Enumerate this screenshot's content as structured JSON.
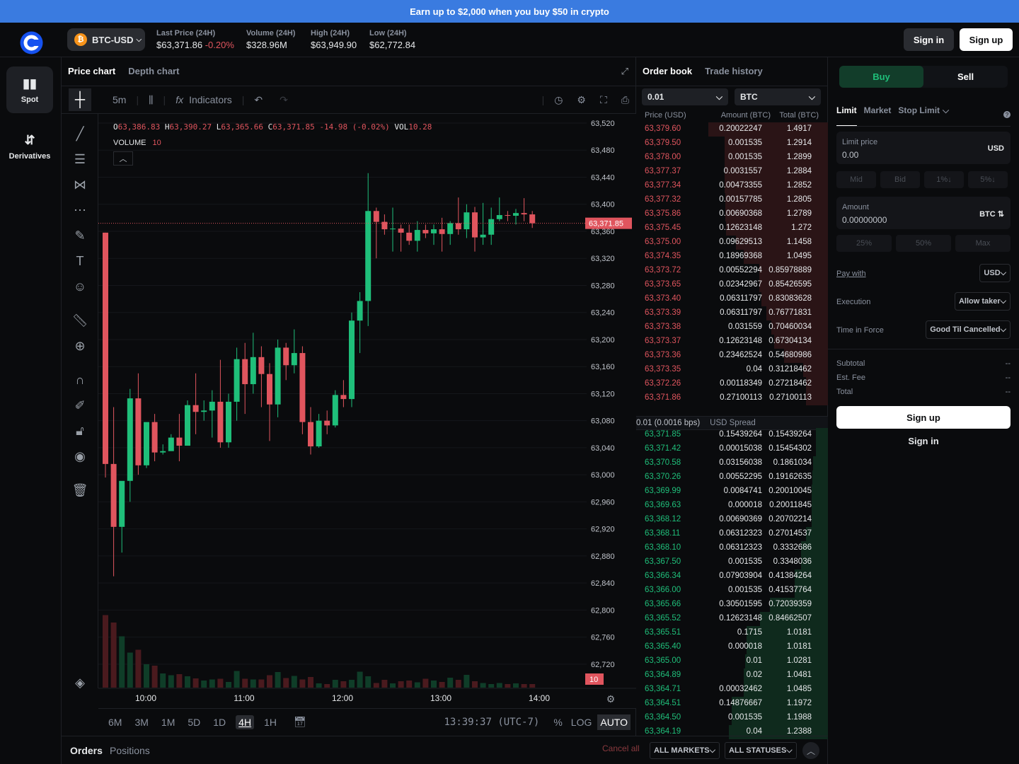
{
  "promo": {
    "text": "Earn up to $2,000 when you buy $50 in crypto"
  },
  "header": {
    "pair": "BTC-USD",
    "coin_icon": "bitcoin-icon",
    "stats": [
      {
        "label": "Last Price (24H)",
        "value": "$63,371.86",
        "change": "-0.20%"
      },
      {
        "label": "Volume (24H)",
        "value": "$328.96M"
      },
      {
        "label": "High (24H)",
        "value": "$63,949.90"
      },
      {
        "label": "Low (24H)",
        "value": "$62,772.84"
      }
    ],
    "signin": "Sign in",
    "signup": "Sign up"
  },
  "nav": {
    "spot": "Spot",
    "derivatives": "Derivatives"
  },
  "chart": {
    "tabs": [
      "Price chart",
      "Depth chart"
    ],
    "interval": "5m",
    "indicators": "Indicators",
    "ohlc": {
      "o": "63,386.83",
      "h": "63,390.27",
      "l": "63,365.66",
      "c": "63,371.85",
      "chg": "-14.98 (-0.02%)",
      "vol": "10.28"
    },
    "volume_label": "VOLUME",
    "volume_value": "10",
    "price_ticks": [
      "63,520",
      "63,480",
      "63,440",
      "63,400",
      "63,360",
      "63,320",
      "63,280",
      "63,240",
      "63,200",
      "63,160",
      "63,120",
      "63,080",
      "63,040",
      "63,000",
      "62,960",
      "62,920",
      "62,880",
      "62,840",
      "62,800",
      "62,760",
      "62,720"
    ],
    "time_ticks": [
      "10:00",
      "11:00",
      "12:00",
      "13:00",
      "14:00"
    ],
    "last_price_tag": "63,371.85",
    "vol_tag": "10",
    "timeframes": [
      "6M",
      "3M",
      "1M",
      "5D",
      "1D",
      "4H",
      "1H"
    ],
    "active_timeframe": "4H",
    "clock": "13:39:37 (UTC-7)",
    "percent": "%",
    "log": "LOG",
    "auto": "AUTO"
  },
  "chart_data": {
    "type": "candlestick",
    "title": "",
    "y_range": [
      62720,
      63540
    ],
    "x": [
      "09:20",
      "09:25",
      "09:30",
      "09:35",
      "09:40",
      "09:45",
      "09:50",
      "09:55",
      "10:00",
      "10:05",
      "10:10",
      "10:15",
      "10:20",
      "10:25",
      "10:30",
      "10:35",
      "10:40",
      "10:45",
      "10:50",
      "10:55",
      "11:00",
      "11:05",
      "11:10",
      "11:15",
      "11:20",
      "11:25",
      "11:30",
      "11:35",
      "11:40",
      "11:45",
      "11:50",
      "11:55",
      "12:00",
      "12:05",
      "12:10",
      "12:15",
      "12:20",
      "12:25",
      "12:30",
      "12:35",
      "12:40",
      "12:45",
      "12:50",
      "12:55",
      "13:00",
      "13:05",
      "13:10",
      "13:15",
      "13:20",
      "13:25",
      "13:30",
      "13:35",
      "13:40"
    ],
    "open": [
      63358,
      63016,
      62923,
      62991,
      63113,
      63014,
      63078,
      63033,
      63035,
      63055,
      63043,
      63103,
      63093,
      63095,
      63108,
      63048,
      63108,
      63171,
      63134,
      63174,
      63149,
      63104,
      63188,
      63162,
      63180,
      63078,
      63042,
      63080,
      63073,
      63118,
      63112,
      63228,
      63257,
      63390,
      63374,
      63363,
      63364,
      63358,
      63346,
      63362,
      63357,
      63363,
      63356,
      63372,
      63363,
      63388,
      63351,
      63355,
      63378,
      63384,
      63383,
      63387,
      63385
    ],
    "close": [
      63016,
      62923,
      62991,
      63113,
      63014,
      63078,
      63033,
      63035,
      63055,
      63043,
      63103,
      63093,
      63095,
      63108,
      63048,
      63108,
      63171,
      63134,
      63174,
      63149,
      63104,
      63188,
      63162,
      63180,
      63078,
      63042,
      63080,
      63073,
      63118,
      63112,
      63228,
      63257,
      63390,
      63374,
      63363,
      63364,
      63358,
      63346,
      63362,
      63357,
      63363,
      63356,
      63372,
      63363,
      63388,
      63351,
      63355,
      63378,
      63384,
      63383,
      63387,
      63385,
      63372
    ],
    "high": [
      63358,
      63100,
      62960,
      63127,
      63150,
      63025,
      63090,
      63045,
      63060,
      63090,
      63110,
      63150,
      63110,
      63125,
      63170,
      63120,
      63188,
      63195,
      63210,
      63190,
      63165,
      63200,
      63195,
      63215,
      63190,
      63100,
      63090,
      63095,
      63125,
      63140,
      63240,
      63270,
      63446,
      63395,
      63385,
      63395,
      63370,
      63370,
      63375,
      63370,
      63370,
      63380,
      63375,
      63410,
      63400,
      63396,
      63402,
      63395,
      63410,
      63390,
      63393,
      63409,
      63390
    ],
    "low": [
      62996,
      62850,
      62885,
      62960,
      63000,
      63010,
      63020,
      63030,
      63040,
      63020,
      63050,
      63060,
      63080,
      63055,
      63040,
      63040,
      63080,
      63090,
      63120,
      63100,
      63050,
      63085,
      63140,
      63150,
      63060,
      63030,
      63040,
      63060,
      63070,
      63100,
      63100,
      63180,
      63220,
      63320,
      63355,
      63330,
      63330,
      63340,
      63330,
      63350,
      63340,
      63330,
      63340,
      63355,
      63350,
      63330,
      63340,
      63340,
      63375,
      63375,
      63370,
      63375,
      63365
    ],
    "volume": [
      205,
      184,
      145,
      99,
      107,
      66,
      62,
      40,
      35,
      38,
      32,
      26,
      20,
      23,
      25,
      16,
      47,
      25,
      23,
      23,
      35,
      44,
      27,
      33,
      23,
      30,
      12,
      10,
      22,
      18,
      22,
      45,
      32,
      13,
      22,
      12,
      18,
      20,
      15,
      25,
      20,
      16,
      28,
      22,
      36,
      18,
      13,
      10,
      13,
      10,
      12,
      10,
      10
    ]
  },
  "orderbook": {
    "tabs": [
      "Order book",
      "Trade history"
    ],
    "aggregation": "0.01",
    "unit": "BTC",
    "headers": [
      "Price (USD)",
      "Amount (BTC)",
      "Total (BTC)"
    ],
    "asks": [
      [
        "63,379.60",
        "0.20022247",
        "1.4917"
      ],
      [
        "63,379.50",
        "0.001535",
        "1.2914"
      ],
      [
        "63,378.00",
        "0.001535",
        "1.2899"
      ],
      [
        "63,377.37",
        "0.0031557",
        "1.2884"
      ],
      [
        "63,377.34",
        "0.00473355",
        "1.2852"
      ],
      [
        "63,377.32",
        "0.00157785",
        "1.2805"
      ],
      [
        "63,375.86",
        "0.00690368",
        "1.2789"
      ],
      [
        "63,375.45",
        "0.12623148",
        "1.272"
      ],
      [
        "63,375.00",
        "0.09629513",
        "1.1458"
      ],
      [
        "63,374.35",
        "0.18969368",
        "1.0495"
      ],
      [
        "63,373.72",
        "0.00552294",
        "0.85978889"
      ],
      [
        "63,373.65",
        "0.02342967",
        "0.85426595"
      ],
      [
        "63,373.40",
        "0.06311797",
        "0.83083628"
      ],
      [
        "63,373.39",
        "0.06311797",
        "0.76771831"
      ],
      [
        "63,373.38",
        "0.031559",
        "0.70460034"
      ],
      [
        "63,373.37",
        "0.12623148",
        "0.67304134"
      ],
      [
        "63,373.36",
        "0.23462524",
        "0.54680986"
      ],
      [
        "63,373.35",
        "0.04",
        "0.31218462"
      ],
      [
        "63,372.26",
        "0.00118349",
        "0.27218462"
      ],
      [
        "63,371.86",
        "0.27100113",
        "0.27100113"
      ]
    ],
    "spread": "0.01 (0.0016 bps)",
    "spread_label": "USD Spread",
    "bids": [
      [
        "63,371.85",
        "0.15439264",
        "0.15439264"
      ],
      [
        "63,371.42",
        "0.00015038",
        "0.15454302"
      ],
      [
        "63,370.58",
        "0.03156038",
        "0.1861034"
      ],
      [
        "63,370.26",
        "0.00552295",
        "0.19162635"
      ],
      [
        "63,369.99",
        "0.0084741",
        "0.20010045"
      ],
      [
        "63,369.63",
        "0.000018",
        "0.20011845"
      ],
      [
        "63,368.12",
        "0.00690369",
        "0.20702214"
      ],
      [
        "63,368.11",
        "0.06312323",
        "0.27014537"
      ],
      [
        "63,368.10",
        "0.06312323",
        "0.3332686"
      ],
      [
        "63,367.50",
        "0.001535",
        "0.3348036"
      ],
      [
        "63,366.34",
        "0.07903904",
        "0.41384264"
      ],
      [
        "63,366.00",
        "0.001535",
        "0.41537764"
      ],
      [
        "63,365.66",
        "0.30501595",
        "0.72039359"
      ],
      [
        "63,365.52",
        "0.12623148",
        "0.84662507"
      ],
      [
        "63,365.51",
        "0.1715",
        "1.0181"
      ],
      [
        "63,365.40",
        "0.000018",
        "1.0181"
      ],
      [
        "63,365.00",
        "0.01",
        "1.0281"
      ],
      [
        "63,364.89",
        "0.02",
        "1.0481"
      ],
      [
        "63,364.71",
        "0.00032462",
        "1.0485"
      ],
      [
        "63,364.51",
        "0.14876667",
        "1.1972"
      ],
      [
        "63,364.50",
        "0.001535",
        "1.1988"
      ],
      [
        "63,364.19",
        "0.04",
        "1.2388"
      ]
    ]
  },
  "trade": {
    "buy": "Buy",
    "sell": "Sell",
    "order_types": [
      "Limit",
      "Market",
      "Stop Limit"
    ],
    "limit_price_label": "Limit price",
    "limit_price_value": "0.00",
    "limit_unit": "USD",
    "price_chips": [
      "Mid",
      "Bid",
      "1%↓",
      "5%↓"
    ],
    "amount_label": "Amount",
    "amount_value": "0.00000000",
    "amount_unit": "BTC ⇅",
    "amount_chips": [
      "25%",
      "50%",
      "Max"
    ],
    "pay_with_label": "Pay with",
    "pay_with_value": "USD",
    "execution_label": "Execution",
    "execution_value": "Allow taker",
    "tif_label": "Time in Force",
    "tif_value": "Good Til Cancelled",
    "subtotal_label": "Subtotal",
    "fee_label": "Est. Fee",
    "total_label": "Total",
    "placeholder": "--",
    "signup": "Sign up",
    "signin": "Sign in"
  },
  "orders": {
    "tabs": [
      "Orders",
      "Positions"
    ],
    "cancel_all": "Cancel all",
    "markets": "ALL MARKETS",
    "statuses": "ALL STATUSES"
  },
  "colors": {
    "up": "#1fbf7a",
    "down": "#e0555e",
    "accent": "#3a7be0",
    "buy": "#123d2a"
  }
}
